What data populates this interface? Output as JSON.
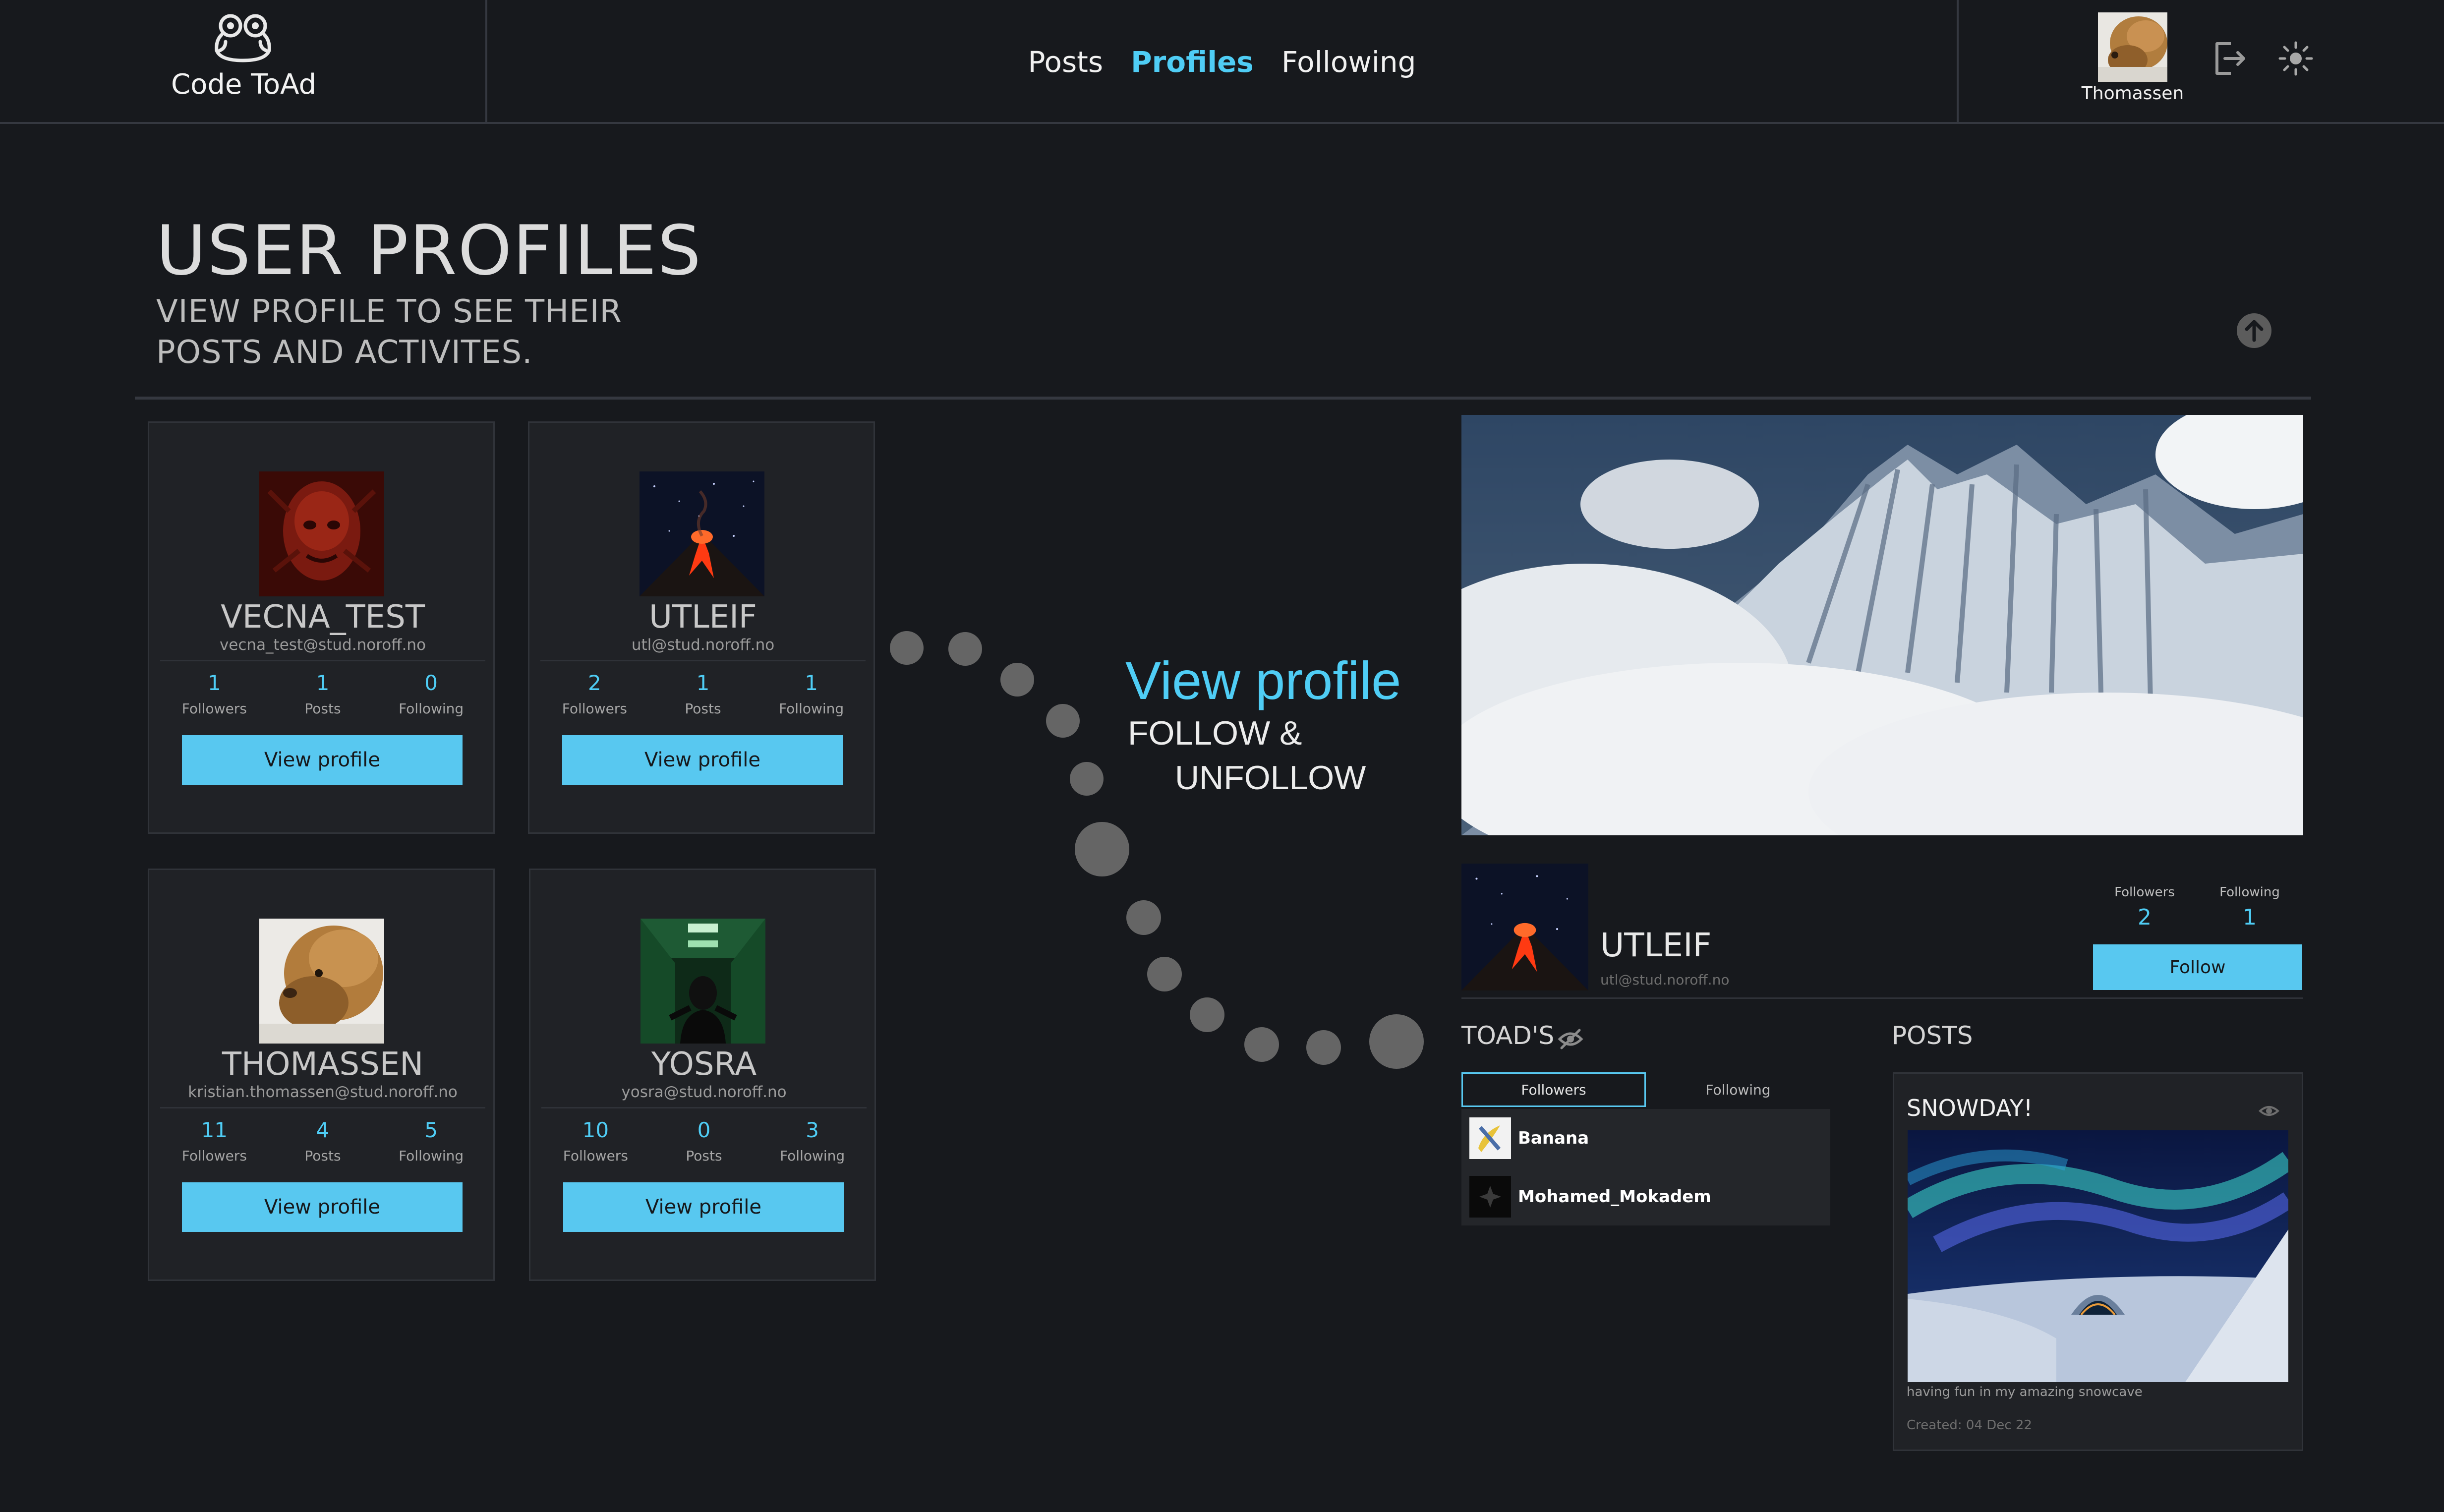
{
  "app": {
    "name": "Code ToAd"
  },
  "nav": {
    "items": [
      {
        "label": "Posts",
        "active": false
      },
      {
        "label": "Profiles",
        "active": true
      },
      {
        "label": "Following",
        "active": false
      }
    ]
  },
  "user": {
    "name": "Thomassen"
  },
  "page": {
    "title": "USER PROFILES",
    "subtitle": "VIEW PROFILE TO SEE THEIR POSTS AND ACTIVITES."
  },
  "stat_labels": {
    "followers": "Followers",
    "posts": "Posts",
    "following": "Following"
  },
  "profiles": [
    {
      "name": "VECNA_TEST",
      "email": "vecna_test@stud.noroff.no",
      "followers": "1",
      "posts": "1",
      "following": "0",
      "button": "View profile"
    },
    {
      "name": "UTLEIF",
      "email": "utl@stud.noroff.no",
      "followers": "2",
      "posts": "1",
      "following": "1",
      "button": "View profile"
    },
    {
      "name": "THOMASSEN",
      "email": "kristian.thomassen@stud.noroff.no",
      "followers": "11",
      "posts": "4",
      "following": "5",
      "button": "View profile"
    },
    {
      "name": "YOSRA",
      "email": "yosra@stud.noroff.no",
      "followers": "10",
      "posts": "0",
      "following": "3",
      "button": "View profile"
    }
  ],
  "annotation": {
    "view": "View profile",
    "follow": "FOLLOW &",
    "unfollow": "UNFOLLOW"
  },
  "preview": {
    "name": "UTLEIF",
    "email": "utl@stud.noroff.no",
    "followers_label": "Followers",
    "followers": "2",
    "following_label": "Following",
    "following": "1",
    "follow_button": "Follow",
    "toads_title": "TOAD'S",
    "tab_followers": "Followers",
    "tab_following": "Following",
    "list": [
      {
        "name": "Banana"
      },
      {
        "name": "Mohamed_Mokadem"
      }
    ],
    "posts_title": "POSTS",
    "post": {
      "title": "SNOWDAY!",
      "body": "having fun in my amazing snowcave",
      "created": "Created: 04 Dec 22"
    }
  },
  "colors": {
    "background": "#17191d",
    "card": "#202226",
    "accent": "#4fcdf5",
    "button": "#58c8f0",
    "border": "#353840"
  },
  "icons": [
    "frog-logo-icon",
    "logout-icon",
    "sun-icon",
    "arrow-up-icon",
    "eye-off-icon",
    "eye-icon"
  ]
}
